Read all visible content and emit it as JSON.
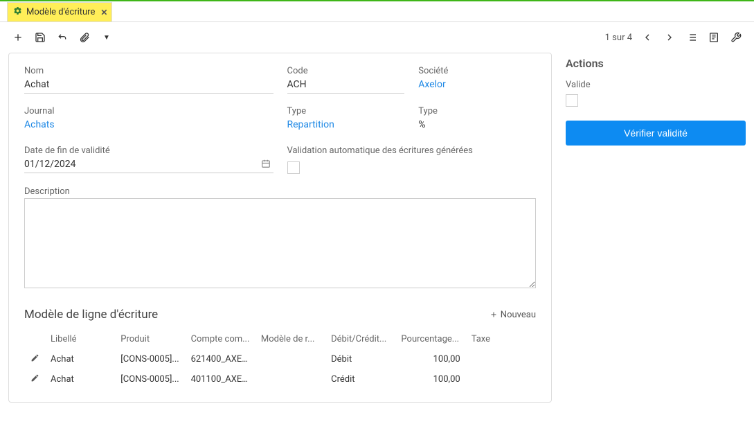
{
  "tab": {
    "title": "Modèle d'écriture"
  },
  "pager": {
    "text": "1 sur 4"
  },
  "form": {
    "nom": {
      "label": "Nom",
      "value": "Achat"
    },
    "code": {
      "label": "Code",
      "value": "ACH"
    },
    "societe": {
      "label": "Société",
      "value": "Axelor"
    },
    "journal": {
      "label": "Journal",
      "value": "Achats"
    },
    "type1": {
      "label": "Type",
      "value": "Repartition"
    },
    "type2": {
      "label": "Type",
      "value": "%"
    },
    "date_fin": {
      "label": "Date de fin de validité",
      "value": "01/12/2024"
    },
    "validation_auto": {
      "label": "Validation automatique des écritures générées"
    },
    "description": {
      "label": "Description",
      "value": ""
    }
  },
  "lines": {
    "title": "Modèle de ligne d'écriture",
    "new_label": "Nouveau",
    "columns": [
      "Libellé",
      "Produit",
      "Compte com...",
      "Modèle de r...",
      "Débit/Crédit...",
      "Pourcentage...",
      "Taxe"
    ],
    "rows": [
      {
        "libelle": "Achat",
        "produit": "[CONS-0005]...",
        "compte": "621400_AXE ...",
        "modele": "",
        "dc": "Débit",
        "pct": "100,00",
        "taxe": ""
      },
      {
        "libelle": "Achat",
        "produit": "[CONS-0005]...",
        "compte": "401100_AXE ...",
        "modele": "",
        "dc": "Crédit",
        "pct": "100,00",
        "taxe": ""
      }
    ]
  },
  "actions": {
    "title": "Actions",
    "valide_label": "Valide",
    "verify_label": "Vérifier validité"
  }
}
